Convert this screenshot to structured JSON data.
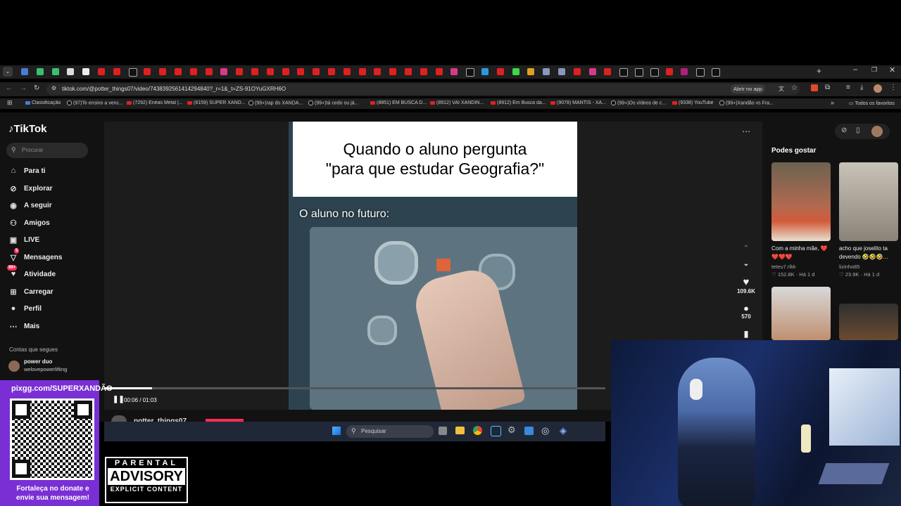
{
  "browser": {
    "url": "tiktok.com/@potter_things07/video/7438392561414294840?_r=1&_t=ZS-91OYuGXRH6O",
    "open_in_app": "Abrir no app",
    "bookmarks": [
      "Classificação",
      "(97)Te ensino a venc...",
      "(7292) Enéas Metal |...",
      "(8159) SUPER XAND...",
      "(99+)rap do XANDÃ...",
      "(99+)tá cedo ou já...",
      "(8851) EM BUSCA D...",
      "(8912) VAI XANDIN...",
      "(8912) Em Busca da...",
      "(9078) MANTIS - XA...",
      "(99+)Os vídeos de c...",
      "(9338) YouTube",
      "(99+)Xandão vs Fra..."
    ],
    "all_favorites": "Todos os favoritos"
  },
  "tiktok": {
    "logo": "TikTok",
    "search_placeholder": "Procurar",
    "nav": [
      {
        "label": "Para ti",
        "icon": "home-icon"
      },
      {
        "label": "Explorar",
        "icon": "compass-icon"
      },
      {
        "label": "A seguir",
        "icon": "following-icon"
      },
      {
        "label": "Amigos",
        "icon": "friends-icon"
      },
      {
        "label": "LIVE",
        "icon": "live-icon"
      },
      {
        "label": "Mensagens",
        "icon": "messages-icon",
        "badge": "5"
      },
      {
        "label": "Atividade",
        "icon": "activity-icon",
        "badge": "99+"
      },
      {
        "label": "Carregar",
        "icon": "upload-icon"
      },
      {
        "label": "Perfil",
        "icon": "profile-icon"
      },
      {
        "label": "Mais",
        "icon": "more-icon"
      }
    ],
    "following_title": "Contas que segues",
    "following": [
      {
        "name": "power duo",
        "handle": "welovepowerlifting"
      }
    ],
    "video": {
      "caption_line1": "Quando o aluno pergunta",
      "caption_line2": "\"para que estudar Geografia?\"",
      "overlay_text": "O aluno no futuro:",
      "time": "00:06 / 01:03",
      "progress": 0.095,
      "author": "potter_things07"
    },
    "actions": {
      "likes": "109.6K",
      "comments": "570"
    },
    "suggestions_title": "Podes gostar",
    "suggestions": [
      {
        "text": "Com a minha mãe, ❤️❤️❤️❤️",
        "user": "teteu7.rlkk",
        "views": "152.8K",
        "age": "Há 1 d"
      },
      {
        "text": "acho que joselito ta devendo 🤣🤣🤣...",
        "user": "lizinho85",
        "views": "23.9K",
        "age": "Há 1 d"
      }
    ]
  },
  "taskbar": {
    "search_placeholder": "Pesquisar"
  },
  "stream": {
    "qr_url": "pixgg.com/SUPERXANDÃO",
    "donate_line1": "Fortaleça no donate e",
    "donate_line2": "envie sua mensagem!",
    "pa_line1": "PARENTAL",
    "pa_line2": "ADVISORY",
    "pa_line3": "EXPLICIT CONTENT"
  },
  "colors": {
    "tiktok_red": "#fe2c55",
    "qr_panel": "#7a2fd4",
    "taskbar": "#202838"
  }
}
